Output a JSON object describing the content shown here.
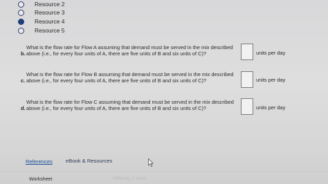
{
  "options": [
    {
      "label": "Resource 2",
      "checked": false
    },
    {
      "label": "Resource 3",
      "checked": false
    },
    {
      "label": "Resource 4",
      "checked": true
    },
    {
      "label": "Resource 5",
      "checked": false
    }
  ],
  "questions": [
    {
      "letter": "b.",
      "text": "What is the flow rate for Flow A assuming that demand must be served in the mix described above (i.e., for every four units of A, there are five units of B and six units of C)?",
      "input_value": "",
      "unit": "units per day"
    },
    {
      "letter": "c.",
      "text": "What is the flow rate for Flow B assuming that demand must be served in the mix described above (i.e., for every four units of A, there are five units of B and six units of C)?",
      "input_value": "",
      "unit": "units per day"
    },
    {
      "letter": "d.",
      "text": "What is the flow rate for Flow C assuming that demand must be served in the mix described above (i.e., for every four units of A, there are five units of B and six units of C)?",
      "input_value": "",
      "unit": "units per day"
    }
  ],
  "footer": {
    "references": "References",
    "ebook": "eBook & Resources",
    "worksheet": "Worksheet",
    "difficulty": "Difficulty: 2 Hard"
  },
  "colors": {
    "link": "#1d4f9a",
    "radio_fill": "#1f3d7a"
  }
}
